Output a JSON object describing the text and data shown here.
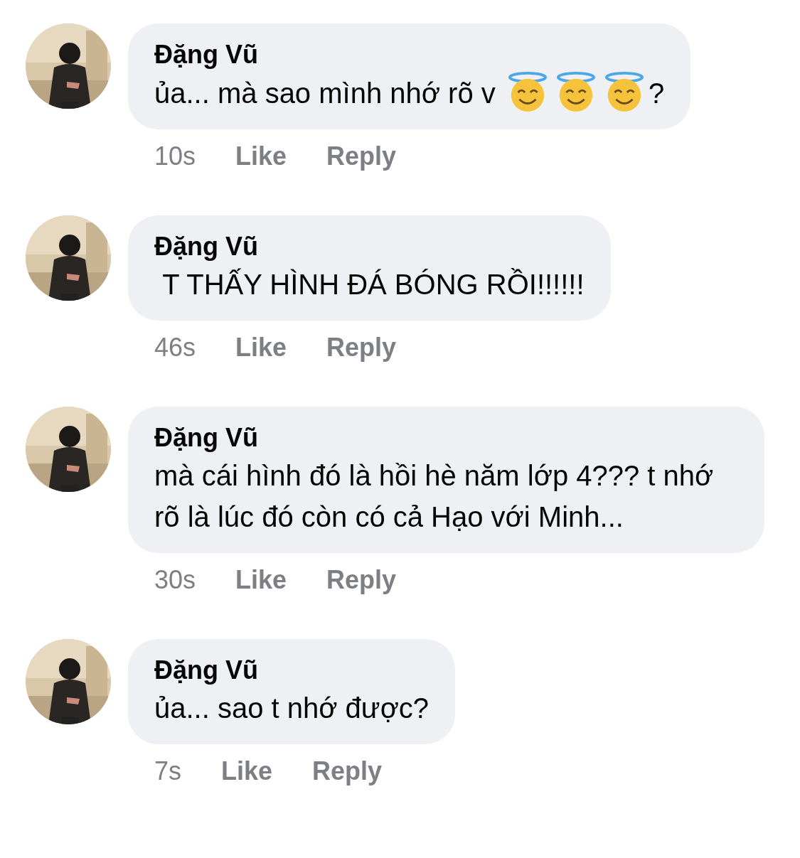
{
  "comments": [
    {
      "author": "Đặng Vũ",
      "message": [
        {
          "kind": "text",
          "text": "ủa... mà sao mình nhớ rõ v "
        },
        {
          "kind": "emoji"
        },
        {
          "kind": "emoji"
        },
        {
          "kind": "emoji"
        },
        {
          "kind": "text",
          "text": "?"
        }
      ],
      "time": "10s",
      "actions": [
        "Like",
        "Reply"
      ]
    },
    {
      "author": "Đặng Vũ",
      "message": [
        {
          "kind": "text",
          "text": " T THẤY HÌNH ĐÁ BÓNG RỒI!!!!!!"
        }
      ],
      "time": "46s",
      "actions": [
        "Like",
        "Reply"
      ]
    },
    {
      "author": "Đặng Vũ",
      "message": [
        {
          "kind": "text",
          "text": "mà cái hình đó là hồi hè năm lớp 4??? t nhớ rõ là lúc đó còn có cả Hạo với Minh..."
        }
      ],
      "time": "30s",
      "actions": [
        "Like",
        "Reply"
      ]
    },
    {
      "author": "Đặng Vũ",
      "message": [
        {
          "kind": "text",
          "text": "ủa... sao t nhớ được?"
        }
      ],
      "time": "7s",
      "actions": [
        "Like",
        "Reply"
      ]
    }
  ]
}
